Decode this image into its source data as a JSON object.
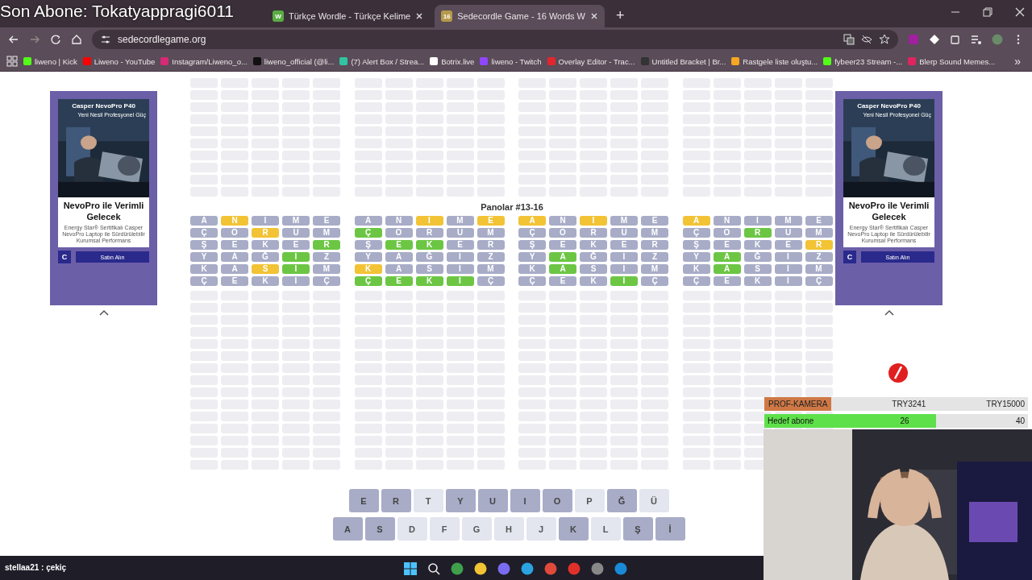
{
  "overlay": {
    "last_subscriber": "Son Abone: Tokatyappragi6011"
  },
  "browser": {
    "tabs": [
      {
        "badge": "W",
        "title": "Türkçe Wordle - Türkçe Kelime",
        "selected": false
      },
      {
        "badge": "16",
        "title": "Sedecordle Game - 16 Words W",
        "selected": true
      }
    ],
    "new_tab": "+",
    "address": "sedecordlegame.org",
    "more": "»",
    "bookmarks": [
      {
        "label": "liweno | Kick",
        "color": "#53fc18"
      },
      {
        "label": "Liweno - YouTube",
        "color": "#ff0000"
      },
      {
        "label": "Instagram/Liweno_o...",
        "color": "#d62976"
      },
      {
        "label": "liweno_official (@li...",
        "color": "#111111"
      },
      {
        "label": "(7) Alert Box / Strea...",
        "color": "#31c3a2"
      },
      {
        "label": "Botrix.live",
        "color": "#ffffff"
      },
      {
        "label": "liweno - Twitch",
        "color": "#9146ff"
      },
      {
        "label": "Overlay Editor - Trac...",
        "color": "#e3262e"
      },
      {
        "label": "Untitled Bracket | Br...",
        "color": "#333333"
      },
      {
        "label": "Rastgele liste oluştu...",
        "color": "#f5a623"
      },
      {
        "label": "fybeer23 Stream -...",
        "color": "#53fc18"
      },
      {
        "label": "Blerp Sound Memes...",
        "color": "#e0245e"
      }
    ]
  },
  "ads": [
    {
      "brand": "Casper NevoPro P40",
      "tagline": "Yeni Nesil Profesyonel Güç",
      "headline": "NevoPro ile Verimli Gelecek",
      "body": "Energy Star® Sertifikalı Casper NevoPro Laptop ile Sürdürülebilir Kurumsal Performans",
      "logo": "C",
      "button": "Satın Alın"
    },
    {
      "brand": "Casper NevoPro P40",
      "tagline": "Yeni Nesil Profesyonel Güç",
      "headline": "NevoPro ile Verimli Gelecek",
      "body": "Energy Star® Sertifikalı Casper NevoPro Laptop ile Sürdürülebilir Kurumsal Performans",
      "logo": "C",
      "button": "Satın Alın"
    }
  ],
  "game": {
    "section_title": "Panolar #13-16",
    "boards": [
      {
        "rows": [
          [
            {
              "letter": "A",
              "color": "#a8acc7"
            },
            {
              "letter": "N",
              "color": "#f2c335"
            },
            {
              "letter": "I",
              "color": "#a8acc7"
            },
            {
              "letter": "M",
              "color": "#a8acc7"
            },
            {
              "letter": "E",
              "color": "#a8acc7"
            }
          ],
          [
            {
              "letter": "Ç",
              "color": "#a8acc7"
            },
            {
              "letter": "O",
              "color": "#a8acc7"
            },
            {
              "letter": "R",
              "color": "#f2c335"
            },
            {
              "letter": "U",
              "color": "#a8acc7"
            },
            {
              "letter": "M",
              "color": "#a8acc7"
            }
          ],
          [
            {
              "letter": "Ş",
              "color": "#a8acc7"
            },
            {
              "letter": "E",
              "color": "#a8acc7"
            },
            {
              "letter": "K",
              "color": "#a8acc7"
            },
            {
              "letter": "E",
              "color": "#a8acc7"
            },
            {
              "letter": "R",
              "color": "#6cc644"
            }
          ],
          [
            {
              "letter": "Y",
              "color": "#a8acc7"
            },
            {
              "letter": "A",
              "color": "#a8acc7"
            },
            {
              "letter": "Ğ",
              "color": "#a8acc7"
            },
            {
              "letter": "I",
              "color": "#6cc644"
            },
            {
              "letter": "Z",
              "color": "#a8acc7"
            }
          ],
          [
            {
              "letter": "K",
              "color": "#a8acc7"
            },
            {
              "letter": "A",
              "color": "#a8acc7"
            },
            {
              "letter": "S",
              "color": "#f2c335"
            },
            {
              "letter": "I",
              "color": "#6cc644"
            },
            {
              "letter": "M",
              "color": "#a8acc7"
            }
          ],
          [
            {
              "letter": "Ç",
              "color": "#a8acc7"
            },
            {
              "letter": "E",
              "color": "#a8acc7"
            },
            {
              "letter": "K",
              "color": "#a8acc7"
            },
            {
              "letter": "I",
              "color": "#a8acc7"
            },
            {
              "letter": "Ç",
              "color": "#a8acc7"
            }
          ]
        ]
      },
      {
        "rows": [
          [
            {
              "letter": "A",
              "color": "#a8acc7"
            },
            {
              "letter": "N",
              "color": "#a8acc7"
            },
            {
              "letter": "I",
              "color": "#f2c335"
            },
            {
              "letter": "M",
              "color": "#a8acc7"
            },
            {
              "letter": "E",
              "color": "#f2c335"
            }
          ],
          [
            {
              "letter": "Ç",
              "color": "#6cc644"
            },
            {
              "letter": "O",
              "color": "#a8acc7"
            },
            {
              "letter": "R",
              "color": "#a8acc7"
            },
            {
              "letter": "U",
              "color": "#a8acc7"
            },
            {
              "letter": "M",
              "color": "#a8acc7"
            }
          ],
          [
            {
              "letter": "Ş",
              "color": "#a8acc7"
            },
            {
              "letter": "E",
              "color": "#6cc644"
            },
            {
              "letter": "K",
              "color": "#6cc644"
            },
            {
              "letter": "E",
              "color": "#a8acc7"
            },
            {
              "letter": "R",
              "color": "#a8acc7"
            }
          ],
          [
            {
              "letter": "Y",
              "color": "#a8acc7"
            },
            {
              "letter": "A",
              "color": "#a8acc7"
            },
            {
              "letter": "Ğ",
              "color": "#a8acc7"
            },
            {
              "letter": "I",
              "color": "#a8acc7"
            },
            {
              "letter": "Z",
              "color": "#a8acc7"
            }
          ],
          [
            {
              "letter": "K",
              "color": "#f2c335"
            },
            {
              "letter": "A",
              "color": "#a8acc7"
            },
            {
              "letter": "S",
              "color": "#a8acc7"
            },
            {
              "letter": "I",
              "color": "#a8acc7"
            },
            {
              "letter": "M",
              "color": "#a8acc7"
            }
          ],
          [
            {
              "letter": "Ç",
              "color": "#6cc644"
            },
            {
              "letter": "E",
              "color": "#6cc644"
            },
            {
              "letter": "K",
              "color": "#6cc644"
            },
            {
              "letter": "I",
              "color": "#6cc644"
            },
            {
              "letter": "Ç",
              "color": "#a8acc7"
            }
          ]
        ]
      },
      {
        "rows": [
          [
            {
              "letter": "A",
              "color": "#f2c335"
            },
            {
              "letter": "N",
              "color": "#a8acc7"
            },
            {
              "letter": "I",
              "color": "#f2c335"
            },
            {
              "letter": "M",
              "color": "#a8acc7"
            },
            {
              "letter": "E",
              "color": "#a8acc7"
            }
          ],
          [
            {
              "letter": "Ç",
              "color": "#a8acc7"
            },
            {
              "letter": "O",
              "color": "#a8acc7"
            },
            {
              "letter": "R",
              "color": "#a8acc7"
            },
            {
              "letter": "U",
              "color": "#a8acc7"
            },
            {
              "letter": "M",
              "color": "#a8acc7"
            }
          ],
          [
            {
              "letter": "Ş",
              "color": "#a8acc7"
            },
            {
              "letter": "E",
              "color": "#a8acc7"
            },
            {
              "letter": "K",
              "color": "#a8acc7"
            },
            {
              "letter": "E",
              "color": "#a8acc7"
            },
            {
              "letter": "R",
              "color": "#a8acc7"
            }
          ],
          [
            {
              "letter": "Y",
              "color": "#a8acc7"
            },
            {
              "letter": "A",
              "color": "#6cc644"
            },
            {
              "letter": "Ğ",
              "color": "#a8acc7"
            },
            {
              "letter": "I",
              "color": "#a8acc7"
            },
            {
              "letter": "Z",
              "color": "#a8acc7"
            }
          ],
          [
            {
              "letter": "K",
              "color": "#a8acc7"
            },
            {
              "letter": "A",
              "color": "#6cc644"
            },
            {
              "letter": "S",
              "color": "#a8acc7"
            },
            {
              "letter": "I",
              "color": "#a8acc7"
            },
            {
              "letter": "M",
              "color": "#a8acc7"
            }
          ],
          [
            {
              "letter": "Ç",
              "color": "#a8acc7"
            },
            {
              "letter": "E",
              "color": "#a8acc7"
            },
            {
              "letter": "K",
              "color": "#a8acc7"
            },
            {
              "letter": "I",
              "color": "#6cc644"
            },
            {
              "letter": "Ç",
              "color": "#a8acc7"
            }
          ]
        ]
      },
      {
        "rows": [
          [
            {
              "letter": "A",
              "color": "#f2c335"
            },
            {
              "letter": "N",
              "color": "#a8acc7"
            },
            {
              "letter": "I",
              "color": "#a8acc7"
            },
            {
              "letter": "M",
              "color": "#a8acc7"
            },
            {
              "letter": "E",
              "color": "#a8acc7"
            }
          ],
          [
            {
              "letter": "Ç",
              "color": "#a8acc7"
            },
            {
              "letter": "O",
              "color": "#a8acc7"
            },
            {
              "letter": "R",
              "color": "#6cc644"
            },
            {
              "letter": "U",
              "color": "#a8acc7"
            },
            {
              "letter": "M",
              "color": "#a8acc7"
            }
          ],
          [
            {
              "letter": "Ş",
              "color": "#a8acc7"
            },
            {
              "letter": "E",
              "color": "#a8acc7"
            },
            {
              "letter": "K",
              "color": "#a8acc7"
            },
            {
              "letter": "E",
              "color": "#a8acc7"
            },
            {
              "letter": "R",
              "color": "#f2c335"
            }
          ],
          [
            {
              "letter": "Y",
              "color": "#a8acc7"
            },
            {
              "letter": "A",
              "color": "#6cc644"
            },
            {
              "letter": "Ğ",
              "color": "#a8acc7"
            },
            {
              "letter": "I",
              "color": "#a8acc7"
            },
            {
              "letter": "Z",
              "color": "#a8acc7"
            }
          ],
          [
            {
              "letter": "K",
              "color": "#a8acc7"
            },
            {
              "letter": "A",
              "color": "#6cc644"
            },
            {
              "letter": "S",
              "color": "#a8acc7"
            },
            {
              "letter": "I",
              "color": "#a8acc7"
            },
            {
              "letter": "M",
              "color": "#a8acc7"
            }
          ],
          [
            {
              "letter": "Ç",
              "color": "#a8acc7"
            },
            {
              "letter": "E",
              "color": "#a8acc7"
            },
            {
              "letter": "K",
              "color": "#a8acc7"
            },
            {
              "letter": "I",
              "color": "#a8acc7"
            },
            {
              "letter": "Ç",
              "color": "#a8acc7"
            }
          ]
        ]
      }
    ],
    "keyboard": [
      [
        {
          "key": "E",
          "used": true
        },
        {
          "key": "R",
          "used": true
        },
        {
          "key": "T",
          "used": false
        },
        {
          "key": "Y",
          "used": true
        },
        {
          "key": "U",
          "used": true
        },
        {
          "key": "I",
          "used": true
        },
        {
          "key": "O",
          "used": true
        },
        {
          "key": "P",
          "used": false
        },
        {
          "key": "Ğ",
          "used": true
        },
        {
          "key": "Ü",
          "used": false
        }
      ],
      [
        {
          "key": "A",
          "used": true
        },
        {
          "key": "S",
          "used": true
        },
        {
          "key": "D",
          "used": false
        },
        {
          "key": "F",
          "used": false
        },
        {
          "key": "G",
          "used": false
        },
        {
          "key": "H",
          "used": false
        },
        {
          "key": "J",
          "used": false
        },
        {
          "key": "K",
          "used": true
        },
        {
          "key": "L",
          "used": false
        },
        {
          "key": "Ş",
          "used": true
        },
        {
          "key": "İ",
          "used": true
        }
      ]
    ]
  },
  "stream": {
    "donation": {
      "label": "PROF-KAMERA",
      "current": "TRY3241",
      "goal": "TRY15000"
    },
    "sub_goal": {
      "label": "Hedef abone",
      "count": "26",
      "target": "40",
      "level": 0.65
    },
    "chat": "stellaa21 : çekiç"
  }
}
